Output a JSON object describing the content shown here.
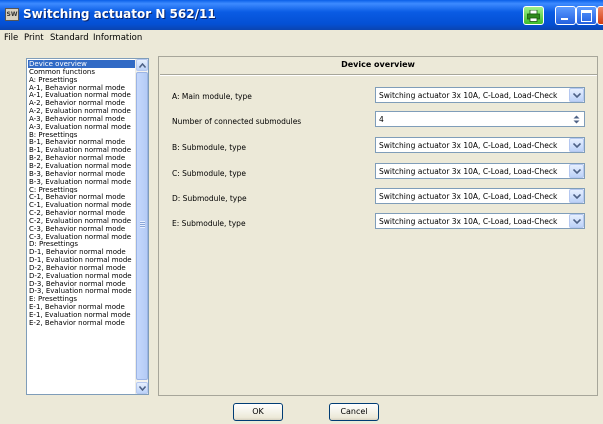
{
  "window": {
    "title": "Switching actuator N 562/11",
    "app_icon_text": "SW"
  },
  "menu": {
    "items": [
      {
        "label": "File"
      },
      {
        "label": "Print"
      },
      {
        "label": "Standard"
      },
      {
        "label": "Information"
      }
    ]
  },
  "sidebar": {
    "items": [
      {
        "label": "Device overview",
        "selected": true
      },
      {
        "label": "Common functions"
      },
      {
        "label": "A: Presettings"
      },
      {
        "label": "A-1, Behavior normal mode"
      },
      {
        "label": "A-1, Evaluation normal mode"
      },
      {
        "label": "A-2, Behavior normal mode"
      },
      {
        "label": "A-2, Evaluation normal mode"
      },
      {
        "label": "A-3, Behavior normal mode"
      },
      {
        "label": "A-3, Evaluation normal mode"
      },
      {
        "label": "B: Presettings"
      },
      {
        "label": "B-1, Behavior normal mode"
      },
      {
        "label": "B-1, Evaluation normal mode"
      },
      {
        "label": "B-2, Behavior normal mode"
      },
      {
        "label": "B-2, Evaluation normal mode"
      },
      {
        "label": "B-3, Behavior normal mode"
      },
      {
        "label": "B-3, Evaluation normal mode"
      },
      {
        "label": "C: Presettings"
      },
      {
        "label": "C-1, Behavior normal mode"
      },
      {
        "label": "C-1, Evaluation normal mode"
      },
      {
        "label": "C-2, Behavior normal mode"
      },
      {
        "label": "C-2, Evaluation normal mode"
      },
      {
        "label": "C-3, Behavior normal mode"
      },
      {
        "label": "C-3, Evaluation normal mode"
      },
      {
        "label": "D: Presettings"
      },
      {
        "label": "D-1, Behavior normal mode"
      },
      {
        "label": "D-1, Evaluation normal mode"
      },
      {
        "label": "D-2, Behavior normal mode"
      },
      {
        "label": "D-2, Evaluation normal mode"
      },
      {
        "label": "D-3, Behavior normal mode"
      },
      {
        "label": "D-3, Evaluation normal mode"
      },
      {
        "label": "E: Presettings"
      },
      {
        "label": "E-1, Behavior normal mode"
      },
      {
        "label": "E-1, Evaluation normal mode"
      },
      {
        "label": "E-2, Behavior normal mode"
      }
    ]
  },
  "panel": {
    "title": "Device overview",
    "rows": [
      {
        "label": "A: Main module, type",
        "value": "Switching actuator 3x 10A, C-Load, Load-Check"
      },
      {
        "label": "Number of connected submodules",
        "value": "4"
      },
      {
        "label": "B: Submodule, type",
        "value": "Switching actuator 3x 10A, C-Load, Load-Check"
      },
      {
        "label": "C: Submodule, type",
        "value": "Switching actuator 3x 10A, C-Load, Load-Check"
      },
      {
        "label": "D: Submodule, type",
        "value": "Switching actuator 3x 10A, C-Load, Load-Check"
      },
      {
        "label": "E: Submodule, type",
        "value": "Switching actuator 3x 10A, C-Load, Load-Check"
      }
    ]
  },
  "buttons": {
    "ok": "OK",
    "cancel": "Cancel"
  },
  "colors": {
    "titlebar": "#0a5ce4",
    "selection": "#316ac5",
    "dialog_bg": "#ece9d8"
  }
}
